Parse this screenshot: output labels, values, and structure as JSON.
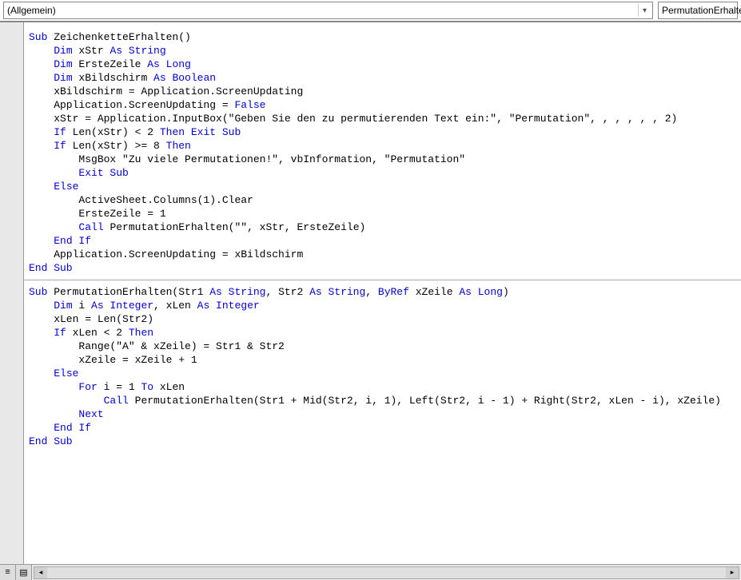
{
  "dropdowns": {
    "object": "(Allgemein)",
    "procedure": "PermutationErhalte"
  },
  "code": {
    "sub1": {
      "l1": [
        "Sub",
        " ZeichenketteErhalten()"
      ],
      "l2": [
        "    ",
        "Dim",
        " xStr ",
        "As String"
      ],
      "l3": [
        "    ",
        "Dim",
        " ErsteZeile ",
        "As Long"
      ],
      "l4": [
        "    ",
        "Dim",
        " xBildschirm ",
        "As Boolean"
      ],
      "l5": [
        "    xBildschirm = Application.ScreenUpdating"
      ],
      "l6": [
        "    Application.ScreenUpdating = ",
        "False"
      ],
      "l7": [
        "    xStr = Application.InputBox(\"Geben Sie den zu permutierenden Text ein:\", \"Permutation\", , , , , , 2)"
      ],
      "l8": [
        "    ",
        "If",
        " Len(xStr) < 2 ",
        "Then Exit Sub"
      ],
      "l9": [
        "    ",
        "If",
        " Len(xStr) >= 8 ",
        "Then"
      ],
      "l10": [
        "        MsgBox \"Zu viele Permutationen!\", vbInformation, \"Permutation\""
      ],
      "l11": [
        "        ",
        "Exit Sub"
      ],
      "l12": [
        "    ",
        "Else"
      ],
      "l13": [
        "        ActiveSheet.Columns(1).Clear"
      ],
      "l14": [
        "        ErsteZeile = 1"
      ],
      "l15": [
        "        ",
        "Call",
        " PermutationErhalten(\"\", xStr, ErsteZeile)"
      ],
      "l16": [
        "    ",
        "End If"
      ],
      "l17": [
        "    Application.ScreenUpdating = xBildschirm"
      ],
      "l18": [
        "End Sub"
      ]
    },
    "sub2": {
      "l1": [
        "Sub",
        " PermutationErhalten(Str1 ",
        "As String",
        ", Str2 ",
        "As String",
        ", ",
        "ByRef",
        " xZeile ",
        "As Long",
        ")"
      ],
      "l2": [
        "    ",
        "Dim",
        " i ",
        "As Integer",
        ", xLen ",
        "As Integer"
      ],
      "l3": [
        "    xLen = Len(Str2)"
      ],
      "l4": [
        "    ",
        "If",
        " xLen < 2 ",
        "Then"
      ],
      "l5": [
        "        Range(\"A\" & xZeile) = Str1 & Str2"
      ],
      "l6": [
        "        xZeile = xZeile + 1"
      ],
      "l7": [
        "    ",
        "Else"
      ],
      "l8": [
        "        ",
        "For",
        " i = 1 ",
        "To",
        " xLen"
      ],
      "l9": [
        "            ",
        "Call",
        " PermutationErhalten(Str1 + Mid(Str2, i, 1), Left(Str2, i - 1) + Right(Str2, xLen - i), xZeile)"
      ],
      "l10": [
        "        ",
        "Next"
      ],
      "l11": [
        "    ",
        "End If"
      ],
      "l12": [
        "End Sub"
      ]
    }
  }
}
